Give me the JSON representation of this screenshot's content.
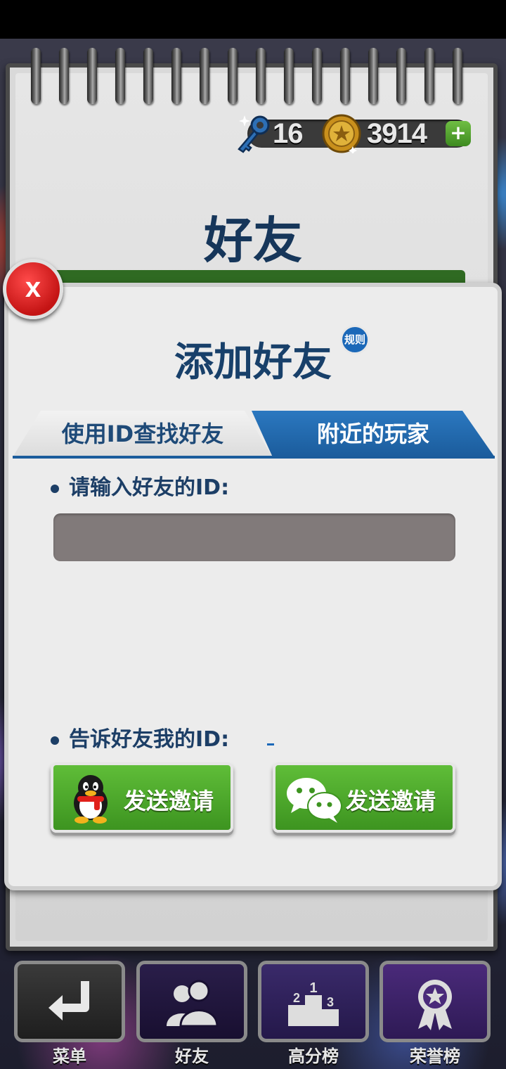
{
  "currency": {
    "keys": "16",
    "coins": "3914",
    "add_label": "+"
  },
  "page_title": "好友",
  "dialog": {
    "title": "添加好友",
    "rules_badge": "规则",
    "close_label": "x",
    "tabs": [
      {
        "label": "使用ID查找好友",
        "active": false
      },
      {
        "label": "附近的玩家",
        "active": true
      }
    ],
    "enter_id_label": "请输入好友的ID:",
    "id_input_value": "",
    "tell_id_label": "告诉好友我的ID:",
    "my_id_value": "",
    "invite_qq_label": "发送邀请",
    "invite_wechat_label": "发送邀请"
  },
  "bottom_nav": [
    {
      "label": "菜单",
      "icon": "return-arrow-icon"
    },
    {
      "label": "好友",
      "icon": "friends-icon"
    },
    {
      "label": "高分榜",
      "icon": "podium-icon"
    },
    {
      "label": "荣誉榜",
      "icon": "medal-icon"
    }
  ],
  "colors": {
    "title_blue": "#16365a",
    "tab_active": "#1b5c9c",
    "button_green": "#4aa82a",
    "close_red": "#d41e1e"
  }
}
